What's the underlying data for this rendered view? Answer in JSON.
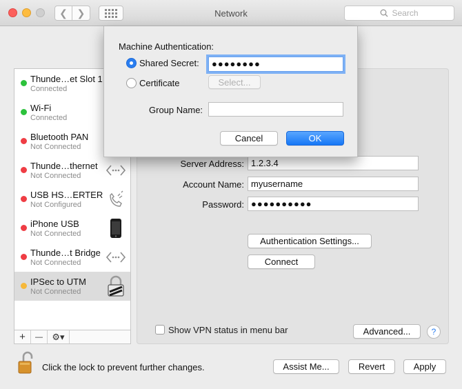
{
  "window": {
    "title": "Network"
  },
  "search": {
    "placeholder": "Search"
  },
  "services": [
    {
      "name": "Thunde…et Slot 1",
      "status": "Connected",
      "dot": "#2cc23c"
    },
    {
      "name": "Wi-Fi",
      "status": "Connected",
      "dot": "#2cc23c"
    },
    {
      "name": "Bluetooth PAN",
      "status": "Not Connected",
      "dot": "#ef3d44"
    },
    {
      "name": "Thunde…thernet",
      "status": "Not Connected",
      "dot": "#ef3d44",
      "icon": "ethernet-arrows-icon"
    },
    {
      "name": "USB HS…ERTER",
      "status": "Not Configured",
      "dot": "#ef3d44",
      "icon": "phone-handset-icon"
    },
    {
      "name": "iPhone USB",
      "status": "Not Connected",
      "dot": "#ef3d44",
      "icon": "iphone-icon"
    },
    {
      "name": "Thunde…t Bridge",
      "status": "Not Connected",
      "dot": "#ef3d44",
      "icon": "ethernet-arrows-icon"
    },
    {
      "name": "IPSec to UTM",
      "status": "Not Connected",
      "dot": "#f6b83a",
      "icon": "vpn-lock-icon",
      "selected": true
    }
  ],
  "sidebar_tools": {
    "add": "+",
    "remove": "—",
    "gear": "⚙▾"
  },
  "vpn": {
    "server_address_label": "Server Address:",
    "server_address": "1.2.3.4",
    "account_name_label": "Account Name:",
    "account_name": "myusername",
    "password_label": "Password:",
    "password": "●●●●●●●●●●",
    "auth_settings_label": "Authentication Settings...",
    "connect_label": "Connect",
    "show_status_label": "Show VPN status in menu bar",
    "show_status_checked": false,
    "advanced_label": "Advanced...",
    "help_label": "?"
  },
  "sheet": {
    "heading": "Machine Authentication:",
    "shared_secret_label": "Shared Secret:",
    "shared_secret_value": "●●●●●●●●",
    "certificate_label": "Certificate",
    "select_label": "Select...",
    "group_name_label": "Group Name:",
    "group_name_value": "",
    "cancel_label": "Cancel",
    "ok_label": "OK",
    "selected_option": "Shared Secret"
  },
  "footer": {
    "lock_text": "Click the lock to prevent further changes.",
    "assist_label": "Assist Me...",
    "revert_label": "Revert",
    "apply_label": "Apply"
  },
  "colors": {
    "accent": "#2a7ef0",
    "connected": "#2cc23c",
    "disconnected": "#ef3d44",
    "pending": "#f6b83a"
  }
}
